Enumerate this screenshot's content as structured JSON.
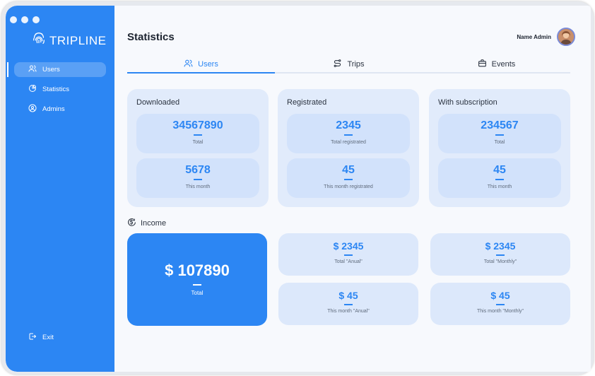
{
  "app": {
    "brand": "TRIPLINE"
  },
  "sidebar": {
    "items": [
      {
        "label": "Users",
        "icon": "users-icon",
        "active": true
      },
      {
        "label": "Statistics",
        "icon": "pie-chart-icon",
        "active": false
      },
      {
        "label": "Admins",
        "icon": "admin-icon",
        "active": false
      }
    ],
    "exit_label": "Exit"
  },
  "header": {
    "title": "Statistics",
    "user_name": "Name Admin"
  },
  "tabs": [
    {
      "label": "Users",
      "icon": "users-icon",
      "active": true
    },
    {
      "label": "Trips",
      "icon": "route-icon",
      "active": false
    },
    {
      "label": "Events",
      "icon": "briefcase-icon",
      "active": false
    }
  ],
  "stats": [
    {
      "label": "Downloaded",
      "top_value": "34567890",
      "top_caption": "Total",
      "bottom_value": "5678",
      "bottom_caption": "This month"
    },
    {
      "label": "Registrated",
      "top_value": "2345",
      "top_caption": "Total registrated",
      "bottom_value": "45",
      "bottom_caption": "This month registrated"
    },
    {
      "label": "With subscription",
      "top_value": "234567",
      "top_caption": "Total",
      "bottom_value": "45",
      "bottom_caption": "This month"
    }
  ],
  "income": {
    "label": "Income",
    "total": {
      "value": "$ 107890",
      "caption": "Total"
    },
    "annual_total": {
      "value": "$ 2345",
      "caption": "Total \"Anual\""
    },
    "monthly_total": {
      "value": "$ 2345",
      "caption": "Total \"Monthly\""
    },
    "annual_month": {
      "value": "$ 45",
      "caption": "This month \"Anual\""
    },
    "monthly_month": {
      "value": "$ 45",
      "caption": "This month \"Monthly\""
    }
  },
  "colors": {
    "accent": "#2c86f3",
    "card": "#e1ebfb",
    "sub_card": "#d2e2fb"
  }
}
